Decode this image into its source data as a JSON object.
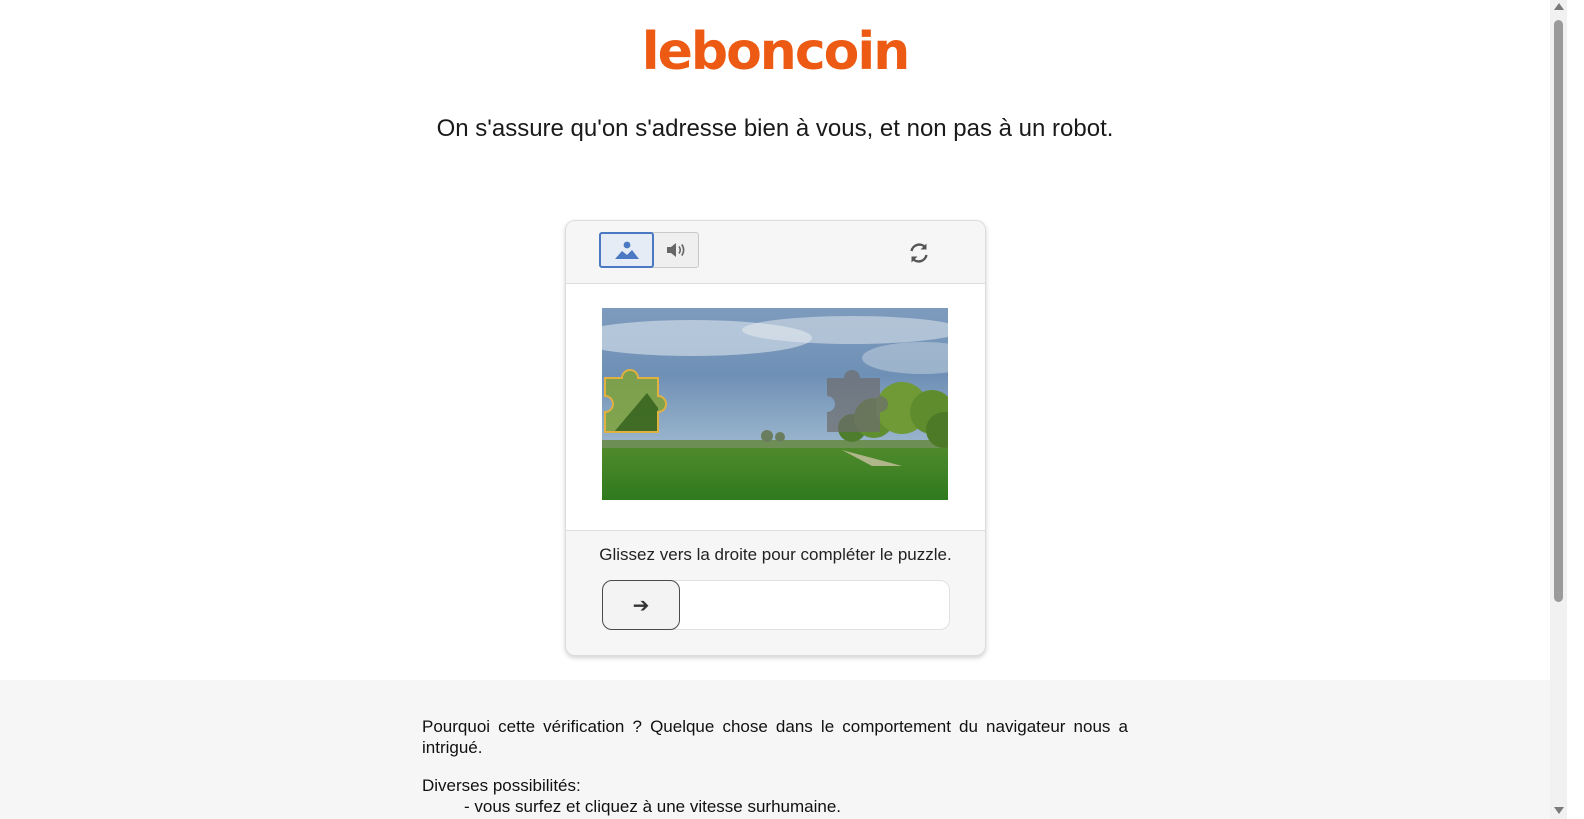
{
  "brand": {
    "logo_text": "leboncoin",
    "accent_color": "#ec5a13"
  },
  "headline": "On s'assure qu'on s'adresse bien à vous, et non pas à un robot.",
  "captcha": {
    "modes": [
      {
        "name": "image",
        "icon": "image-icon",
        "selected": true
      },
      {
        "name": "audio",
        "icon": "speaker-icon",
        "selected": false
      }
    ],
    "refresh_icon": "refresh-icon",
    "instruction": "Glissez vers la droite pour compléter le puzzle.",
    "slider_icon": "➔",
    "selected_color": "#4a78c2"
  },
  "info": {
    "why": "Pourquoi cette vérification ? Quelque chose dans le comportement du navigateur nous a intrigué.",
    "possibilities_title": "Diverses possibilités:",
    "possibilities": [
      "- vous surfez et cliquez à une vitesse surhumaine."
    ]
  }
}
